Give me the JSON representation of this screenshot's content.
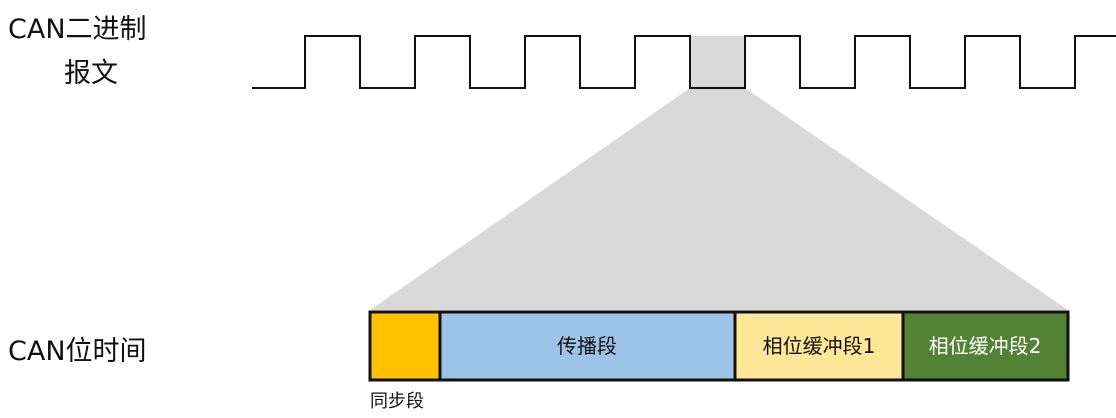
{
  "labels": {
    "binary_message_line1": "CAN二进制",
    "binary_message_line2": "报文",
    "bit_time": "CAN位时间"
  },
  "segments": [
    {
      "id": "sync",
      "label": "同步段",
      "fill": "#FFC000",
      "text_color": "#111111"
    },
    {
      "id": "prop",
      "label": "传播段",
      "fill": "#9DC3E6",
      "text_color": "#111111"
    },
    {
      "id": "phase1",
      "label": "相位缓冲段1",
      "fill": "#FFE699",
      "text_color": "#111111"
    },
    {
      "id": "phase2",
      "label": "相位缓冲段2",
      "fill": "#548235",
      "text_color": "#ffffff"
    }
  ],
  "colors": {
    "signal_line": "#111111",
    "zoom_fill": "#d9d9d9",
    "segment_border": "#111111"
  }
}
